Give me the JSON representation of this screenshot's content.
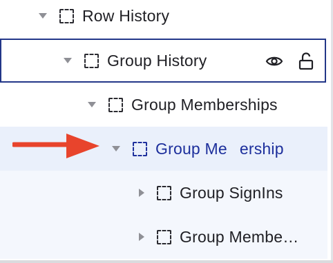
{
  "colors": {
    "selected_text": "#1d2f9c",
    "selected_row_bg": "#eaf0fb",
    "child_row_bg": "#f4f7fd",
    "focus_border": "#223688",
    "arrow": "#e8442c"
  },
  "tree": {
    "rows": [
      {
        "label": "Row History",
        "icon": "dashed-frame-icon",
        "expanded": true
      },
      {
        "label": "Group History",
        "icon": "dashed-frame-icon",
        "expanded": true,
        "actions": [
          "eye-icon",
          "unlock-icon"
        ]
      },
      {
        "label": "Group Memberships",
        "icon": "dashed-frame-icon",
        "expanded": true
      },
      {
        "label_left": "Group Me",
        "label_right": "ership",
        "icon": "dashed-frame-icon",
        "expanded": true,
        "selected": true
      },
      {
        "label": "Group SignIns",
        "icon": "dashed-frame-icon",
        "expanded": false
      },
      {
        "label": "Group Membe…",
        "icon": "dashed-frame-icon",
        "expanded": false
      }
    ]
  },
  "annotation": {
    "icon": "red-arrow-icon"
  }
}
